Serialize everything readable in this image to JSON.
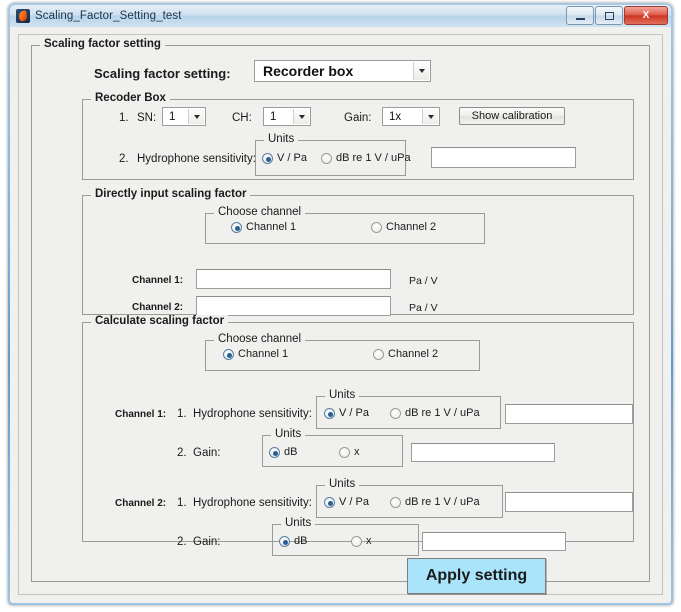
{
  "window": {
    "title": "Scaling_Factor_Setting_test",
    "app_icon": "matlab-icon",
    "controls": {
      "minimize": "minimize-button",
      "maximize": "maximize-button",
      "close_glyph": "X"
    }
  },
  "main_panel": {
    "title": "Scaling factor setting",
    "mode_label": "Scaling factor setting:",
    "mode_value": "Recorder box",
    "mode_options": [
      "Recorder box",
      "Directly input scaling factor",
      "Calculate scaling factor"
    ]
  },
  "recorder_box": {
    "title": "Recoder Box",
    "row1_number": "1.",
    "sn_label": "SN:",
    "sn_value": "1",
    "ch_label": "CH:",
    "ch_value": "1",
    "gain_label": "Gain:",
    "gain_value": "1x",
    "show_calibration_label": "Show calibration",
    "row2_number": "2.",
    "hydrophone_label": "Hydrophone sensitivity:",
    "units_title": "Units",
    "unit_vpa": "V / Pa",
    "unit_db": "dB re 1 V / uPa",
    "unit_selected": "V / Pa",
    "value": ""
  },
  "direct_input": {
    "title": "Directly input scaling factor",
    "choose_channel_title": "Choose channel",
    "channel1_radio": "Channel 1",
    "channel2_radio": "Channel 2",
    "channel_selected": "Channel 1",
    "ch1_label": "Channel 1:",
    "ch1_value": "",
    "ch1_unit": "Pa / V",
    "ch2_label": "Channel 2:",
    "ch2_value": "",
    "ch2_unit": "Pa / V"
  },
  "calculate": {
    "title": "Calculate scaling factor",
    "choose_channel_title": "Choose channel",
    "channel1_radio": "Channel 1",
    "channel2_radio": "Channel 2",
    "channel_selected": "Channel 1",
    "ch1_tag": "Channel 1:",
    "ch2_tag": "Channel 2:",
    "units_title": "Units",
    "hydrophone_number": "1.",
    "hydrophone_label": "Hydrophone sensitivity:",
    "unit_vpa": "V / Pa",
    "unit_db": "dB re 1 V / uPa",
    "hydrophone_unit_selected": "V / Pa",
    "gain_number": "2.",
    "gain_label": "Gain:",
    "gain_unit_db": "dB",
    "gain_unit_x": "x",
    "gain_unit_selected": "dB",
    "ch1_hydrophone_value": "",
    "ch1_gain_value": "",
    "ch2_hydrophone_value": "",
    "ch2_gain_value": ""
  },
  "apply": {
    "label": "Apply setting",
    "color": "#aae4fb"
  }
}
